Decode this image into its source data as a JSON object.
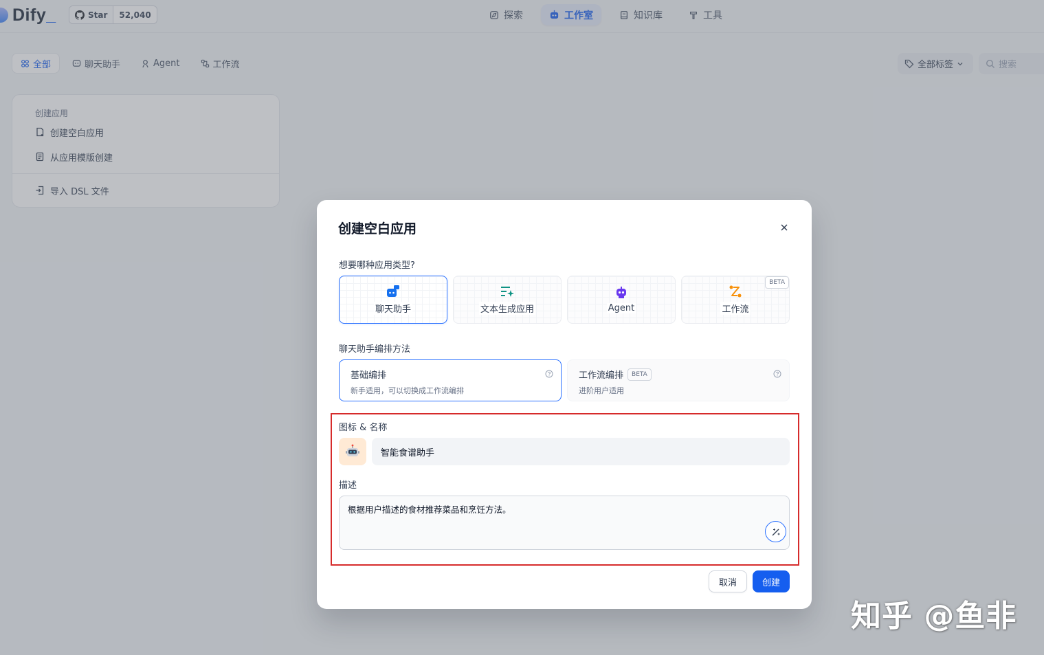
{
  "app": {
    "logo_text": "Dify",
    "github": {
      "star_label": "Star",
      "count": "52,040"
    }
  },
  "nav": {
    "items": [
      {
        "label": "探索",
        "icon": "compass-icon"
      },
      {
        "label": "工作室",
        "icon": "robot-icon",
        "active": true
      },
      {
        "label": "知识库",
        "icon": "book-icon"
      },
      {
        "label": "工具",
        "icon": "hammer-icon"
      }
    ]
  },
  "filters": {
    "tabs": [
      {
        "label": "全部",
        "icon": "grid-icon",
        "active": true
      },
      {
        "label": "聊天助手",
        "icon": "chat-icon"
      },
      {
        "label": "Agent",
        "icon": "agent-icon"
      },
      {
        "label": "工作流",
        "icon": "workflow-icon"
      }
    ],
    "tag_select": "全部标签",
    "search_placeholder": "搜索"
  },
  "create_card": {
    "title": "创建应用",
    "items": [
      "创建空白应用",
      "从应用模版创建",
      "导入 DSL 文件"
    ]
  },
  "modal": {
    "title": "创建空白应用",
    "type_question": "想要哪种应用类型?",
    "types": [
      {
        "label": "聊天助手",
        "icon": "chat-bot-icon",
        "selected": true
      },
      {
        "label": "文本生成应用",
        "icon": "text-generate-icon"
      },
      {
        "label": "Agent",
        "icon": "agent-robot-icon"
      },
      {
        "label": "工作流",
        "icon": "workflow-route-icon",
        "badge": "BETA"
      }
    ],
    "mode_label": "聊天助手编排方法",
    "modes": [
      {
        "title": "基础编排",
        "desc": "新手适用，可以切换成工作流编排",
        "selected": true
      },
      {
        "title": "工作流编排",
        "badge": "BETA",
        "desc": "进阶用户适用"
      }
    ],
    "icon_name_label": "图标 & 名称",
    "app_name": "智能食谱助手",
    "description_label": "描述",
    "description": "根据用户描述的食材推荐菜品和烹饪方法。",
    "cancel": "取消",
    "create": "创建"
  },
  "watermark": "知乎 @鱼非",
  "colors": {
    "primary": "#155eef",
    "highlight_border": "#d62b2b",
    "icon_bg": "#ffead5"
  }
}
